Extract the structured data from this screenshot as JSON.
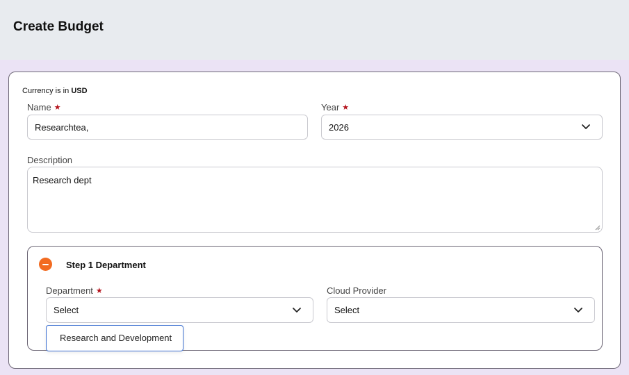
{
  "header": {
    "title": "Create Budget"
  },
  "form": {
    "currency_prefix": "Currency is in",
    "currency_code": "USD",
    "required_marker": "★",
    "name": {
      "label": "Name",
      "value": "Researchtea,"
    },
    "year": {
      "label": "Year",
      "value": "2026",
      "icon": "chevron-down-icon"
    },
    "description": {
      "label": "Description",
      "value": "Research dept"
    },
    "step": {
      "title": "Step 1 Department",
      "toggle_icon": "minus-circle-icon",
      "department": {
        "label": "Department",
        "value": "Select",
        "icon": "chevron-down-icon"
      },
      "cloud_provider": {
        "label": "Cloud Provider",
        "value": "Select",
        "icon": "chevron-down-icon"
      },
      "department_options": [
        "Research and Development"
      ]
    }
  },
  "colors": {
    "accent_orange": "#f26b21",
    "required_red": "#b4121b",
    "focus_blue": "#3b6fd1",
    "header_bg": "#e8ebef",
    "page_bg": "#ebe3f5"
  }
}
